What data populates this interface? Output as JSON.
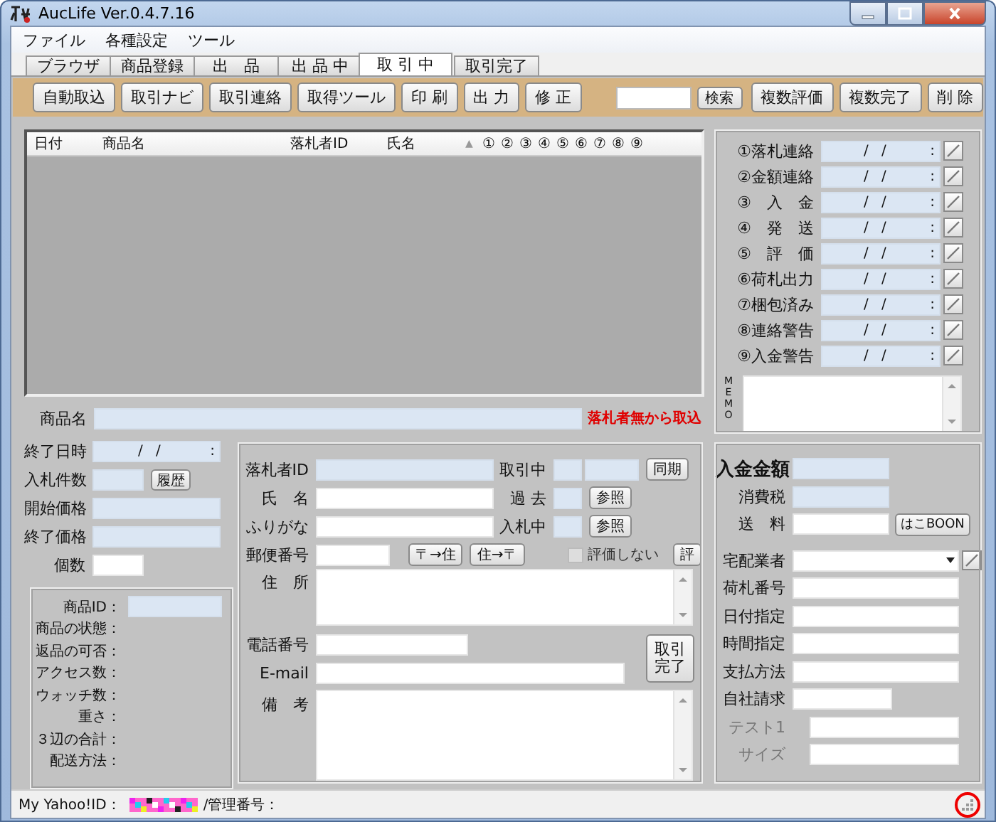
{
  "window": {
    "title": "AucLife Ver.0.4.7.16"
  },
  "menu": [
    {
      "label": "ファイル"
    },
    {
      "label": "各種設定"
    },
    {
      "label": "ツール"
    }
  ],
  "tabs": [
    {
      "label": "ブラウザ",
      "selected": false
    },
    {
      "label": "商品登録",
      "selected": false
    },
    {
      "label": "出　品",
      "selected": false
    },
    {
      "label": "出 品 中",
      "selected": false
    },
    {
      "label": "取 引 中",
      "selected": true
    },
    {
      "label": "取引完了",
      "selected": false
    }
  ],
  "toolbar": {
    "buttons": [
      "自動取込",
      "取引ナビ",
      "取引連絡",
      "取得ツール",
      "印 刷",
      "出 力",
      "修 正"
    ],
    "search_button": "検索",
    "actions": [
      "複数評価",
      "複数完了",
      "削 除"
    ]
  },
  "list": {
    "columns": [
      "日付",
      "商品名",
      "落札者ID",
      "氏名"
    ],
    "sort_mark": "▲",
    "step_columns": [
      "①",
      "②",
      "③",
      "④",
      "⑤",
      "⑥",
      "⑦",
      "⑧",
      "⑨"
    ]
  },
  "progress": {
    "steps": [
      {
        "label": "①落札連絡",
        "date": "/ /",
        "time": ":"
      },
      {
        "label": "②金額連絡",
        "date": "/ /",
        "time": ":"
      },
      {
        "label": "③　入　金",
        "date": "/ /",
        "time": ":"
      },
      {
        "label": "④　発　送",
        "date": "/ /",
        "time": ":"
      },
      {
        "label": "⑤　評　価",
        "date": "/ /",
        "time": ":"
      },
      {
        "label": "⑥荷札出力",
        "date": "/ /",
        "time": ":"
      },
      {
        "label": "⑦梱包済み",
        "date": "/ /",
        "time": ":"
      },
      {
        "label": "⑧連絡警告",
        "date": "/ /",
        "time": ":"
      },
      {
        "label": "⑨入金警告",
        "date": "/ /",
        "time": ":"
      }
    ],
    "memo_label": "MEMO"
  },
  "item": {
    "label": "商品名",
    "readonly": true,
    "link": "落札者無から取込"
  },
  "auction": {
    "fields": [
      {
        "label": "終了日時",
        "kind": "datetime",
        "date": "/ /",
        "time": ":",
        "readonly": true
      },
      {
        "label": "入札件数",
        "kind": "count",
        "button": "履歴",
        "readonly": true
      },
      {
        "label": "開始価格",
        "kind": "text",
        "readonly": true
      },
      {
        "label": "終了価格",
        "kind": "text",
        "readonly": true
      },
      {
        "label": "個数",
        "kind": "count",
        "readonly": false
      }
    ],
    "details": [
      {
        "label": "商品ID：",
        "kind": "field"
      },
      {
        "label": "商品の状態：",
        "kind": "plain"
      },
      {
        "label": "返品の可否：",
        "kind": "plain"
      },
      {
        "label": "アクセス数：",
        "kind": "plain"
      },
      {
        "label": "ウォッチ数：",
        "kind": "plain"
      },
      {
        "label": "重さ：",
        "kind": "plain"
      },
      {
        "label": "３辺の合計：",
        "kind": "plain"
      },
      {
        "label": "配送方法：",
        "kind": "plain"
      }
    ]
  },
  "buyer": {
    "id": {
      "label": "落札者ID",
      "readonly": true
    },
    "name": {
      "label": "氏　名",
      "readonly": false
    },
    "kana": {
      "label": "ふりがな",
      "readonly": false
    },
    "trading": {
      "label": "取引中",
      "button": "同期"
    },
    "past": {
      "label": "過 去",
      "button": "参照"
    },
    "bidding": {
      "label": "入札中",
      "button": "参照"
    },
    "postal": {
      "label": "郵便番号",
      "to_address": "〒→住",
      "to_postal": "住→〒"
    },
    "no_rating": {
      "label": "評価しない",
      "checked": false
    },
    "rate_button": "評",
    "address": {
      "label": "住　所"
    },
    "phone": {
      "label": "電話番号"
    },
    "email": {
      "label": "E-mail"
    },
    "complete_button": "取引完了",
    "note": {
      "label": "備　考"
    }
  },
  "payment": {
    "fields": [
      {
        "label": "入金金額",
        "kind": "amount",
        "readonly": true,
        "disabled": false
      },
      {
        "label": "消費税",
        "kind": "short",
        "readonly": true,
        "disabled": false
      },
      {
        "label": "送　料",
        "kind": "button",
        "button": "はこBOON",
        "readonly": false,
        "disabled": false
      },
      {
        "label": "宅配業者",
        "kind": "select",
        "readonly": false,
        "disabled": false
      },
      {
        "label": "荷札番号",
        "kind": "text",
        "readonly": false,
        "disabled": false
      },
      {
        "label": "日付指定",
        "kind": "text",
        "readonly": false,
        "disabled": false
      },
      {
        "label": "時間指定",
        "kind": "text",
        "readonly": false,
        "disabled": false
      },
      {
        "label": "支払方法",
        "kind": "text",
        "readonly": false,
        "disabled": false
      },
      {
        "label": "自社請求",
        "kind": "short",
        "readonly": false,
        "disabled": false
      },
      {
        "label": "テスト1",
        "kind": "text",
        "readonly": false,
        "disabled": true
      },
      {
        "label": "サイズ",
        "kind": "text",
        "readonly": false,
        "disabled": true
      }
    ]
  },
  "status_bar": {
    "id_label": "My Yahoo!ID：",
    "number_label": "/管理番号："
  }
}
